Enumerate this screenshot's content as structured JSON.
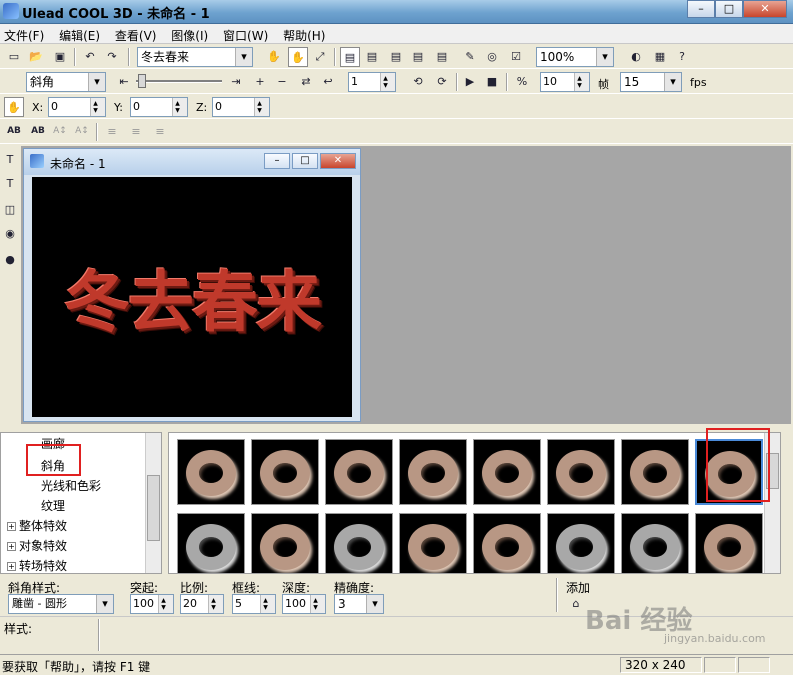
{
  "window": {
    "title": "Ulead COOL 3D - 未命名 - 1",
    "min": "–",
    "max": "□",
    "close": "✕"
  },
  "menu": [
    "文件(F)",
    "编辑(E)",
    "查看(V)",
    "图像(I)",
    "窗口(W)",
    "帮助(H)"
  ],
  "toolbar1": {
    "text_select": "冬去春来",
    "zoom": "100%"
  },
  "toolbar2": {
    "effect_select": "斜角",
    "frame_value": "1",
    "frames_total": "10",
    "frames_label": "帧",
    "fps_value": "15",
    "fps_label": "fps"
  },
  "toolbar3": {
    "x_label": "X:",
    "x_value": "0",
    "y_label": "Y:",
    "y_value": "0",
    "z_label": "Z:",
    "z_value": "0"
  },
  "toolbar4": {
    "b1": "AB",
    "b2": "AB",
    "b3": "A↕",
    "b4": "A↕"
  },
  "document": {
    "title": "未命名 - 1",
    "text": "冬去春来"
  },
  "tree": {
    "items": [
      {
        "label": "画廊",
        "expander": ""
      },
      {
        "label": "斜角",
        "expander": ""
      },
      {
        "label": "光线和色彩",
        "expander": ""
      },
      {
        "label": "纹理",
        "expander": ""
      },
      {
        "label": "整体特效",
        "expander": "+"
      },
      {
        "label": "对象特效",
        "expander": "+"
      },
      {
        "label": "转场特效",
        "expander": "+"
      }
    ]
  },
  "gallery": {
    "selected_index": 7,
    "count": 16
  },
  "props": {
    "bevel_style_label": "斜角样式:",
    "bevel_style_value": "雕凿 - 圆形",
    "bulge_label": "突起:",
    "bulge_value": "100",
    "scale_label": "比例:",
    "scale_value": "20",
    "border_label": "框线:",
    "border_value": "5",
    "depth_label": "深度:",
    "depth_value": "100",
    "precision_label": "精确度:",
    "precision_value": "3",
    "add_label": "添加"
  },
  "style_label": "样式:",
  "status": {
    "help": "要获取「帮助」，请按 F1 键",
    "size": "320 x 240"
  },
  "watermark": {
    "text": "Bai 经验",
    "sub": "jingyan.baidu.com"
  },
  "colors": {
    "accent": "#4a8ad8",
    "highlight_box": "#e02020",
    "text3d": "#c0392b"
  }
}
